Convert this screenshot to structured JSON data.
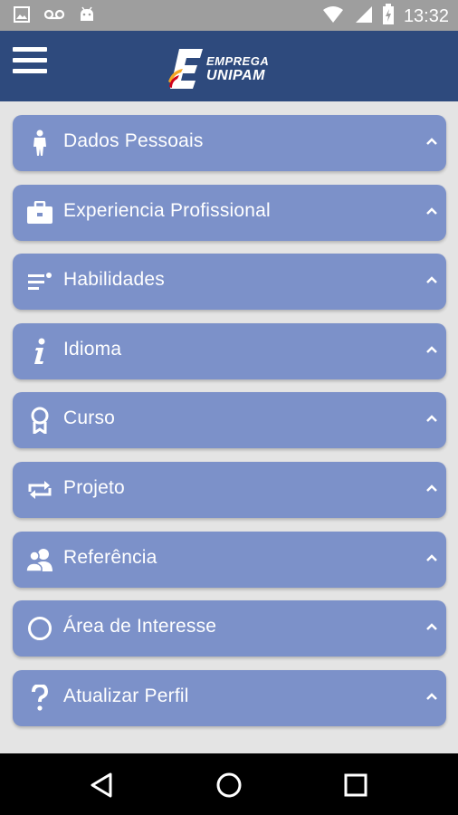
{
  "status_bar": {
    "time": "13:32",
    "left_icons": [
      "image-icon",
      "voicemail-icon",
      "android-icon"
    ],
    "right_icons": [
      "wifi-icon",
      "signal-icon",
      "battery-charging-icon"
    ]
  },
  "header": {
    "logo_line1": "EMPREGA",
    "logo_line2": "UNIPAM",
    "menu_icon": "hamburger-menu-icon"
  },
  "sections": [
    {
      "label": "Dados Pessoais",
      "icon": "person-icon"
    },
    {
      "label": "Experiencia Profissional",
      "icon": "briefcase-icon"
    },
    {
      "label": "Habilidades",
      "icon": "list-icon"
    },
    {
      "label": "Idioma",
      "icon": "info-icon"
    },
    {
      "label": "Curso",
      "icon": "award-icon"
    },
    {
      "label": "Projeto",
      "icon": "repeat-icon"
    },
    {
      "label": "Referência",
      "icon": "users-icon"
    },
    {
      "label": "Área de Interesse",
      "icon": "circle-icon"
    },
    {
      "label": "Atualizar Perfil",
      "icon": "question-icon"
    }
  ],
  "colors": {
    "appbar": "#2e4a7d",
    "item": "#7c91c9",
    "background": "#e4e4e4",
    "statusbar": "#9e9e9e"
  },
  "nav_bar": [
    "back-icon",
    "home-icon",
    "recents-icon"
  ]
}
